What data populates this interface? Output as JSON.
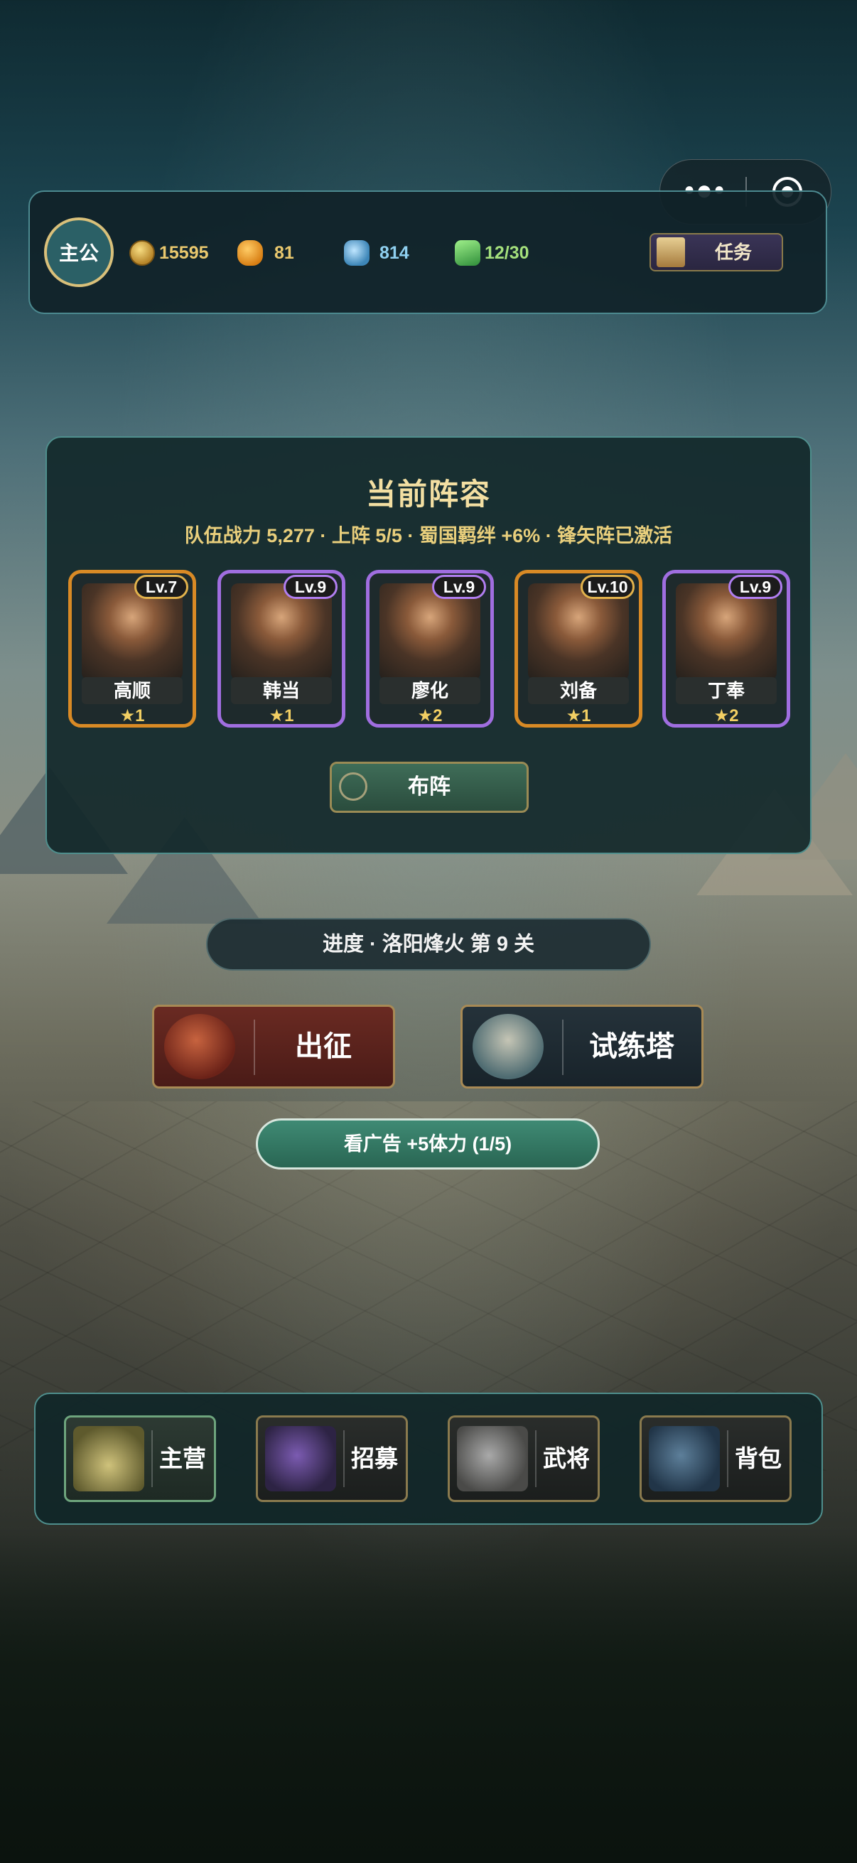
{
  "miniprogram_capsule": {
    "menu_icon": "more-dots-icon",
    "close_icon": "target-close-icon"
  },
  "topbar": {
    "avatar_label": "主公",
    "gold": "15595",
    "ingot": "81",
    "jade": "814",
    "stamina": "12/30",
    "quest_label": "任务",
    "icons": [
      "gold-coin-icon",
      "ingot-icon",
      "jade-icon",
      "stamina-icon",
      "scroll-icon"
    ]
  },
  "formation": {
    "title": "当前阵容",
    "summary": "队伍战力 5,277 · 上阵 5/5 · 蜀国羁绊 +6% · 锋矢阵已激活",
    "heroes": [
      {
        "name": "高顺",
        "level": "Lv.7",
        "stars": "★1",
        "frame": "orange"
      },
      {
        "name": "韩当",
        "level": "Lv.9",
        "stars": "★1",
        "frame": "purple"
      },
      {
        "name": "廖化",
        "level": "Lv.9",
        "stars": "★2",
        "frame": "purple"
      },
      {
        "name": "刘备",
        "level": "Lv.10",
        "stars": "★1",
        "frame": "orange"
      },
      {
        "name": "丁奉",
        "level": "Lv.9",
        "stars": "★2",
        "frame": "purple"
      }
    ],
    "deploy_label": "布阵"
  },
  "progress_label": "进度 · 洛阳烽火  第 9 关",
  "actions": {
    "campaign_label": "出征",
    "tower_label": "试练塔"
  },
  "ad_label": "看广告 +5体力 (1/5)",
  "nav": {
    "items": [
      {
        "label": "主营",
        "icon": "camp-tent-icon"
      },
      {
        "label": "招募",
        "icon": "recruit-scroll-icon"
      },
      {
        "label": "武将",
        "icon": "general-helmet-icon"
      },
      {
        "label": "背包",
        "icon": "bag-icon"
      }
    ]
  },
  "colors": {
    "accent_teal": "#4f8f8d",
    "gold_text": "#e9c86e",
    "orange_frame": "#d98a25",
    "purple_frame": "#a06ee0"
  }
}
